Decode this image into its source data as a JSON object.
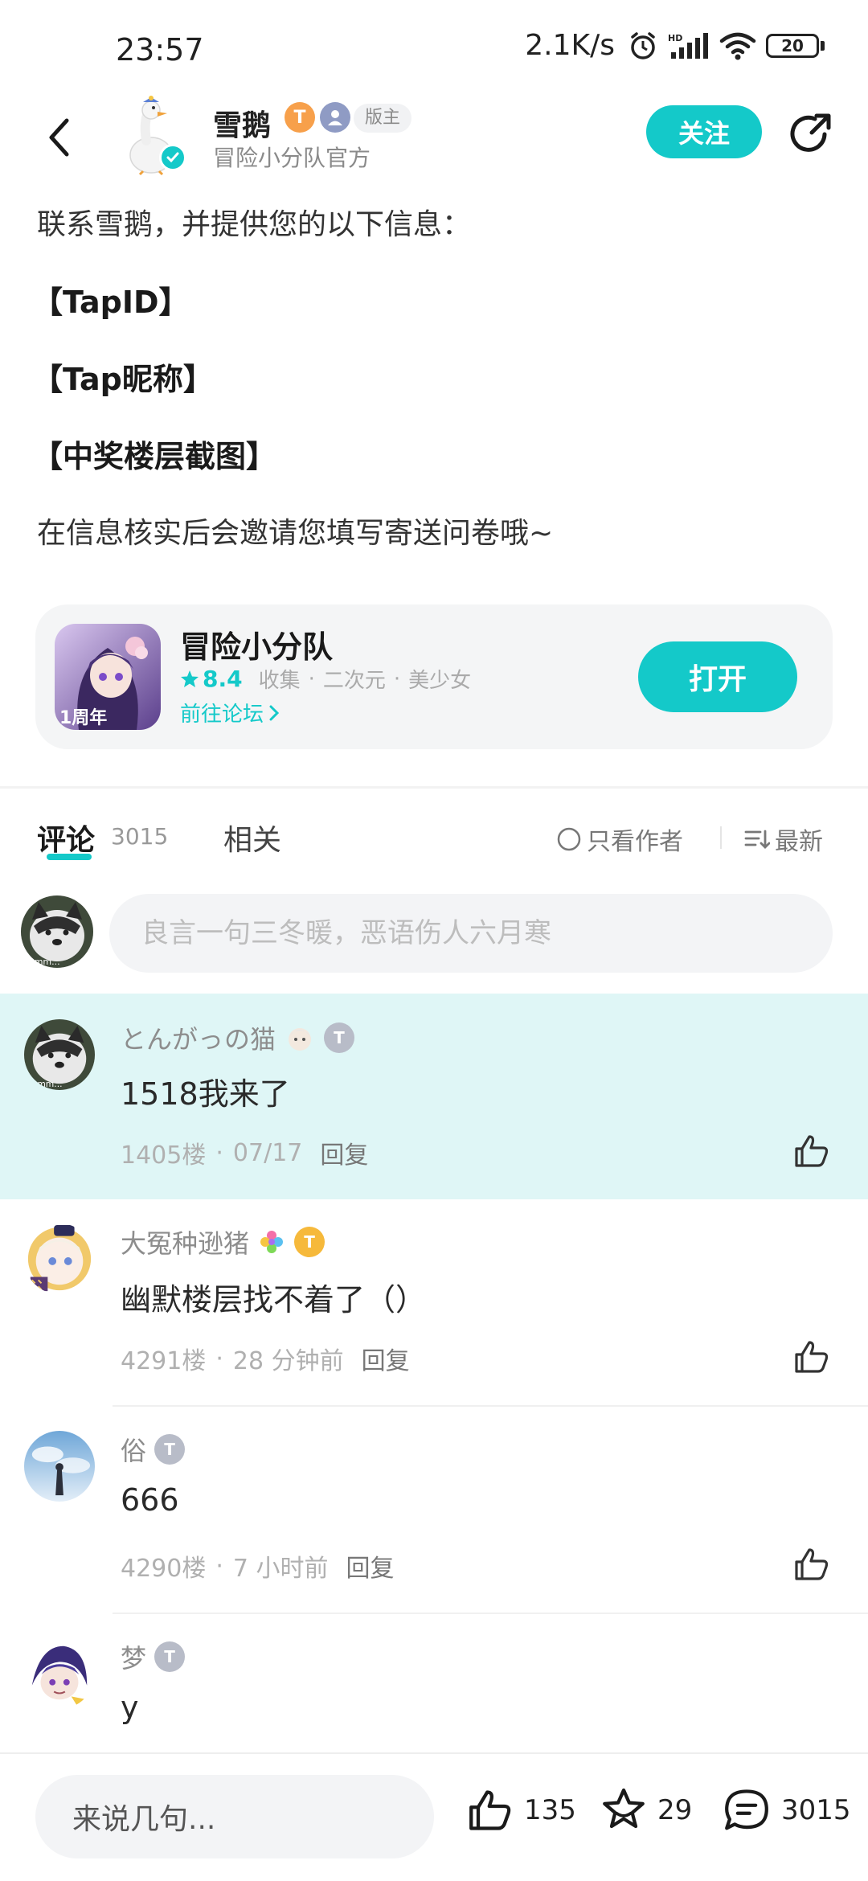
{
  "status_bar": {
    "time": "23:57",
    "net_speed": "2.1K/s",
    "battery": "20",
    "icons": [
      "alarm-icon",
      "hd-signal-icon",
      "wifi-icon",
      "battery-icon"
    ]
  },
  "header": {
    "author_name": "雪鹅",
    "author_sub": "冒险小分队官方",
    "level_badge": "T",
    "moderator_tag": "版主",
    "follow_label": "关注"
  },
  "article": {
    "line1": "联系雪鹅，并提供您的以下信息：",
    "item1": "【TapID】",
    "item2": "【Tap昵称】",
    "item3": "【中奖楼层截图】",
    "line2": "在信息核实后会邀请您填写寄送问卷哦~"
  },
  "app_card": {
    "name": "冒险小分队",
    "score": "8.4",
    "tags": [
      "收集",
      "二次元",
      "美少女"
    ],
    "forum_link": "前往论坛",
    "icon_text": "1周年",
    "open_label": "打开"
  },
  "tabs": {
    "comment_label": "评论",
    "comment_count": "3015",
    "related_label": "相关",
    "only_author_label": "只看作者",
    "sort_label": "最新"
  },
  "comment_input": {
    "placeholder": "良言一句三冬暖，恶语伤人六月寒",
    "avatar_text": "mmm..."
  },
  "comments": [
    {
      "user": "とんがっの猫",
      "text": "1518我来了",
      "floor": "1405楼",
      "time": "07/17",
      "reply": "回复",
      "avatar_text": "mmm..."
    },
    {
      "user": "大冤种逊猪",
      "text": "幽默楼层找不着了（）",
      "floor": "4291楼",
      "time": "28 分钟前",
      "reply": "回复"
    },
    {
      "user": "俗",
      "text": "666",
      "floor": "4290楼",
      "time": "7 小时前",
      "reply": "回复"
    },
    {
      "user": "梦",
      "text": "y"
    }
  ],
  "bottom_bar": {
    "input_placeholder": "来说几句...",
    "like_count": "135",
    "fav_count": "29",
    "comment_count": "3015"
  },
  "colors": {
    "accent": "#14c9c9",
    "highlight_bg": "#dff6f6"
  }
}
